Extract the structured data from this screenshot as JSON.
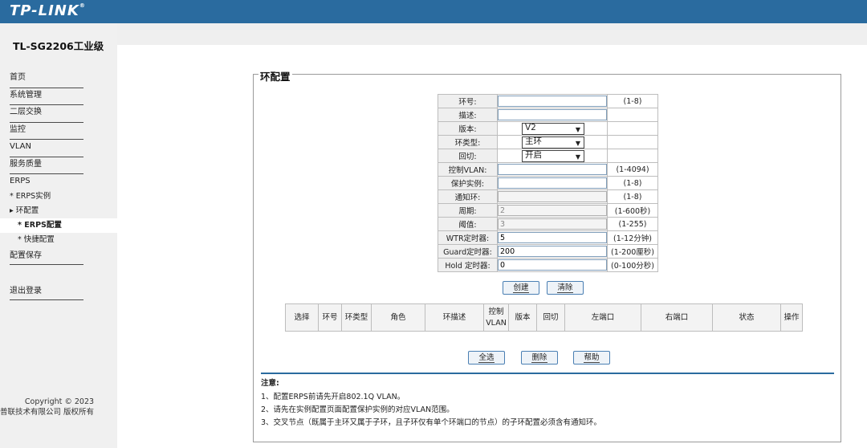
{
  "brand": {
    "logo": "TP-LINK",
    "mark": "®"
  },
  "model": "TL-SG2206工业级",
  "nav": {
    "items": [
      "首页",
      "系统管理",
      "二层交换",
      "监控",
      "VLAN",
      "服务质量"
    ],
    "erps": "ERPS",
    "sub": [
      "* ERPS实例",
      "▸ 环配置"
    ],
    "subsub": [
      "* ERPS配置",
      "* 快捷配置"
    ],
    "save": "配置保存",
    "logout": "退出登录"
  },
  "copyright": {
    "line1": "Copyright © 2023",
    "line2": "普联技术有限公司 版权所有"
  },
  "section_title": "环配置",
  "form": {
    "ring_id": {
      "label": "环号:",
      "value": "",
      "range": "(1-8)"
    },
    "desc": {
      "label": "描述:",
      "value": ""
    },
    "version": {
      "label": "版本:",
      "value": "V2"
    },
    "ring_type": {
      "label": "环类型:",
      "value": "主环"
    },
    "revert": {
      "label": "回切:",
      "value": "开启"
    },
    "ctrl_vlan": {
      "label": "控制VLAN:",
      "value": "",
      "range": "(1-4094)"
    },
    "protect_inst": {
      "label": "保护实例:",
      "value": "",
      "range": "(1-8)"
    },
    "notify_ring": {
      "label": "通知环:",
      "value": "",
      "range": "(1-8)"
    },
    "period": {
      "label": "周期:",
      "value": "2",
      "range": "(1-600秒)"
    },
    "threshold": {
      "label": "阈值:",
      "value": "3",
      "range": "(1-255)"
    },
    "wtr": {
      "label": "WTR定时器:",
      "value": "5",
      "range": "(1-12分钟)"
    },
    "guard": {
      "label": "Guard定时器:",
      "value": "200",
      "range": "(1-200厘秒)"
    },
    "hold": {
      "label": "Hold 定时器:",
      "value": "0",
      "range": "(0-100分秒)"
    }
  },
  "buttons": {
    "create": "创建",
    "clear": "清除",
    "select_all": "全选",
    "delete": "删除",
    "help": "帮助"
  },
  "table": {
    "headers": [
      "选择",
      "环号",
      "环类型",
      "角色",
      "环描述",
      "控制",
      "VLAN",
      "版本",
      "回切",
      "左端口",
      "右端口",
      "状态",
      "操作"
    ]
  },
  "notes": {
    "title": "注意:",
    "items": [
      "1、配置ERPS前请先开启802.1Q VLAN。",
      "2、请先在实例配置页面配置保护实例的对应VLAN范围。",
      "3、交叉节点（既属于主环又属于子环，且子环仅有单个环端口的节点）的子环配置必须含有通知环。"
    ]
  }
}
